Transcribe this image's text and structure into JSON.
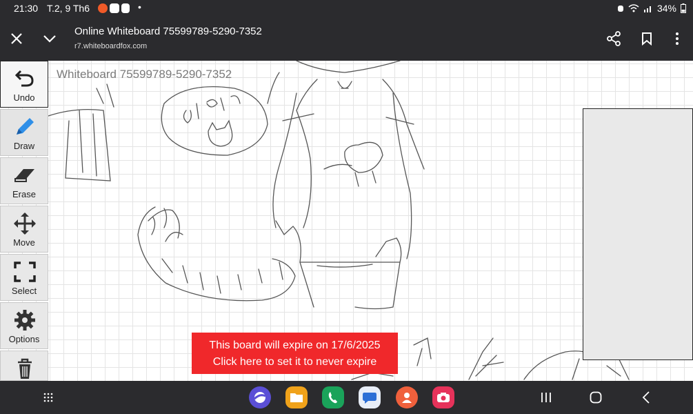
{
  "status": {
    "time": "21:30",
    "date": "T.2, 9 Th6",
    "dot": "•",
    "battery": "34%",
    "icons": [
      "alarm-icon",
      "wifi-icon",
      "signal-icon"
    ]
  },
  "browser": {
    "title": "Online Whiteboard 75599789-5290-7352",
    "url": "r7.whiteboardfox.com"
  },
  "board": {
    "title": "Whiteboard 75599789-5290-7352",
    "grid_color": "#e4e4e4"
  },
  "toolbar": {
    "tools": [
      {
        "label": "Undo",
        "icon": "undo-icon"
      },
      {
        "label": "Draw",
        "icon": "pencil-icon"
      },
      {
        "label": "Erase",
        "icon": "eraser-icon"
      },
      {
        "label": "Move",
        "icon": "move-icon"
      },
      {
        "label": "Select",
        "icon": "select-icon"
      },
      {
        "label": "Options",
        "icon": "gear-icon"
      },
      {
        "label": "",
        "icon": "trash-icon"
      }
    ]
  },
  "banner": {
    "line1": "This board will expire on 17/6/2025",
    "line2": "Click here to set it to never expire",
    "color": "#f0282b"
  },
  "dock": {
    "apps": [
      {
        "name": "browser-app-icon",
        "color": "#5b4fd6"
      },
      {
        "name": "files-app-icon",
        "color": "#f0a21a"
      },
      {
        "name": "phone-app-icon",
        "color": "#1aa35a"
      },
      {
        "name": "messages-app-icon",
        "color": "#e8eef8"
      },
      {
        "name": "contacts-app-icon",
        "color": "#f0603c"
      },
      {
        "name": "camera-app-icon",
        "color": "#e6325a"
      }
    ]
  }
}
